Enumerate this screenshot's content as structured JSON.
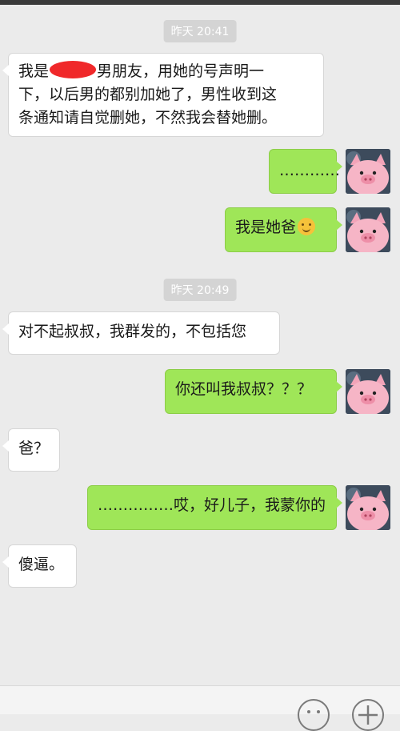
{
  "timestamps": [
    "昨天 20:41",
    "昨天 20:49"
  ],
  "messages": {
    "m1_prefix": "我是",
    "m1_line1_rest": "男朋友，用她的号声明一",
    "m1_line2": "下，以后男的都别加她了，男性收到这",
    "m1_line3": "条通知请自觉删她，不然我会替她删。",
    "m2": "…………",
    "m3": "我是她爸",
    "m4": "对不起叔叔，我群发的，不包括您",
    "m5": "你还叫我叔叔？？？",
    "m6": "爸？",
    "m7": "……………哎，好儿子，我蒙你的",
    "m8": "傻逼。"
  },
  "icons": {
    "avatar": "pink-pig-avatar-icon",
    "emoji": "smiley-emoji-icon",
    "emoji_button": "emoji-face-icon",
    "more_button": "plus-icon"
  },
  "colors": {
    "background": "#ebebeb",
    "incoming_bubble": "#ffffff",
    "outgoing_bubble": "#9fe658",
    "timestamp_chip": "#d4d4d4",
    "redaction": "#f0282a"
  }
}
